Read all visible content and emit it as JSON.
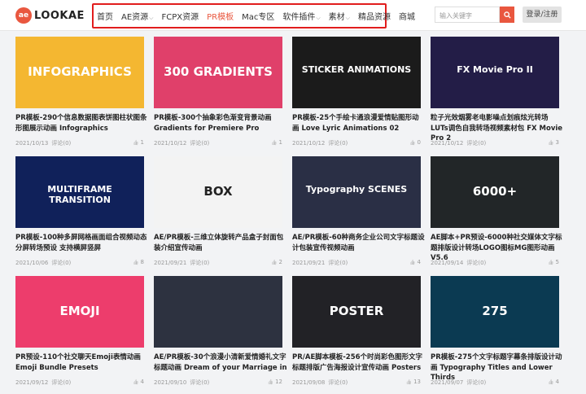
{
  "logo": {
    "badge": "ae",
    "text": "LOOKAE"
  },
  "nav": [
    {
      "label": "首页",
      "caret": false,
      "active": false
    },
    {
      "label": "AE资源",
      "caret": true,
      "active": false
    },
    {
      "label": "FCPX资源",
      "caret": false,
      "active": false
    },
    {
      "label": "PR模板",
      "caret": false,
      "active": true
    },
    {
      "label": "Mac专区",
      "caret": false,
      "active": false
    },
    {
      "label": "软件插件",
      "caret": true,
      "active": false
    },
    {
      "label": "素材",
      "caret": true,
      "active": false
    },
    {
      "label": "精品资源",
      "caret": false,
      "active": false
    },
    {
      "label": "商城",
      "caret": false,
      "active": false
    }
  ],
  "search": {
    "placeholder": "输入关键字"
  },
  "login": {
    "label": "登录/注册"
  },
  "accent": "#e9573f",
  "cards": [
    {
      "title": "PR模板-290个信息数据图表饼图柱状图条形图展示动画 Infographics",
      "date": "2021/10/13",
      "comments": "评论(0)",
      "likes": "1",
      "thumb_text": "INFOGRAPHICS",
      "thumb_bg": "#f4b731"
    },
    {
      "title": "PR模板-300个抽象彩色渐变背景动画 Gradients for Premiere Pro",
      "date": "2021/10/12",
      "comments": "评论(0)",
      "likes": "1",
      "thumb_text": "300 GRADIENTS",
      "thumb_bg": "#e0406a"
    },
    {
      "title": "PR模板-25个手绘卡通浪漫爱情贴图形动画 Love Lyric Animations 02",
      "date": "2021/10/12",
      "comments": "评论(0)",
      "likes": "0",
      "thumb_text": "STICKER ANIMATIONS",
      "thumb_bg": "#1b1b1b"
    },
    {
      "title": "粒子光效烟雾老电影噪点划痕炫光转场LUTs调色自我转场视频素材包 FX Movie Pro 2",
      "date": "2021/10/12",
      "comments": "评论(0)",
      "likes": "3",
      "thumb_text": "FX Movie Pro II",
      "thumb_bg": "#231d47"
    },
    {
      "title": "PR模板-100种多屏网格画面组合视频动态分屏转场预设 支持横屏竖屏",
      "date": "2021/10/06",
      "comments": "评论(0)",
      "likes": "8",
      "thumb_text": "MULTIFRAME TRANSITION",
      "thumb_bg": "#10215a"
    },
    {
      "title": "AE/PR模板-三维立体旋转产品盒子封面包装介绍宣传动画",
      "date": "2021/09/21",
      "comments": "评论(0)",
      "likes": "2",
      "thumb_text": "BOX",
      "thumb_bg": "#f3f3f3"
    },
    {
      "title": "AE/PR模板-60种商务企业公司文字标题设计包装宣传视频动画",
      "date": "2021/09/21",
      "comments": "评论(0)",
      "likes": "4",
      "thumb_text": "Typography SCENES",
      "thumb_bg": "#2a2f45"
    },
    {
      "title": "AE脚本+PR预设-6000种社交媒体文字标题排版设计转场LOGO图标MG图形动画 V5.6",
      "date": "2021/09/14",
      "comments": "评论(0)",
      "likes": "5",
      "thumb_text": "6000+",
      "thumb_bg": "#222628"
    },
    {
      "title": "PR预设-110个社交聊天Emoji表情动画 Emoji Bundle Presets",
      "date": "2021/09/12",
      "comments": "评论(0)",
      "likes": "4",
      "thumb_text": "EMOJI",
      "thumb_bg": "#ed3d6c"
    },
    {
      "title": "AE/PR模板-30个浪漫小清新爱情婚礼文字标题动画 Dream of your Marriage in",
      "date": "2021/09/10",
      "comments": "评论(0)",
      "likes": "12",
      "thumb_text": "",
      "thumb_bg": "#2d3240"
    },
    {
      "title": "PR/AE脚本模板-256个时尚彩色图形文字标题排版广告海报设计宣传动画 Posters",
      "date": "2021/09/08",
      "comments": "评论(0)",
      "likes": "13",
      "thumb_text": "POSTER",
      "thumb_bg": "#222226"
    },
    {
      "title": "PR模板-275个文字标题字幕条排版设计动画 Typography Titles and Lower Thirds",
      "date": "2021/09/07",
      "comments": "评论(0)",
      "likes": "4",
      "thumb_text": "275",
      "thumb_bg": "#0b3a52"
    }
  ]
}
